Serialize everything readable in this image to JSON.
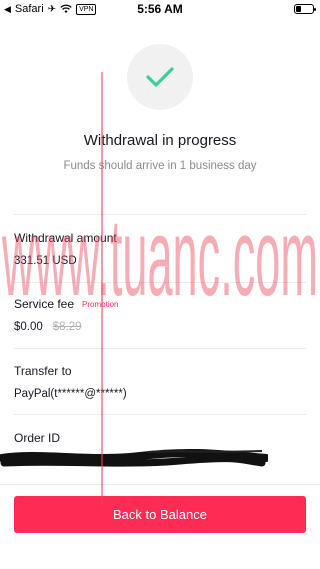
{
  "status_bar": {
    "back_app": "Safari",
    "vpn_label": "VPN",
    "time": "5:56 AM"
  },
  "header": {
    "title": "Withdrawal in progress",
    "subtitle": "Funds should arrive in 1 business day"
  },
  "details": {
    "withdrawal_amount_label": "Withdrawal amount",
    "withdrawal_amount_value": "331.51 USD",
    "service_fee_label": "Service fee",
    "service_fee_tag": "Promotion",
    "service_fee_value": "$0.00",
    "service_fee_original": "$8.29",
    "transfer_to_label": "Transfer to",
    "transfer_to_value": "PayPal(t******@******)",
    "order_id_label": "Order ID"
  },
  "actions": {
    "back_label": "Back to Balance"
  },
  "watermark_text": "www.tuanc.com",
  "colors": {
    "accent": "#fe2c55",
    "success_check": "#3fcc9a",
    "muted_text": "#8a8b91",
    "circle_bg": "#f1f1f2"
  },
  "icons": {
    "success": "checkmark-icon",
    "wifi": "wifi-icon",
    "battery": "battery-icon"
  }
}
